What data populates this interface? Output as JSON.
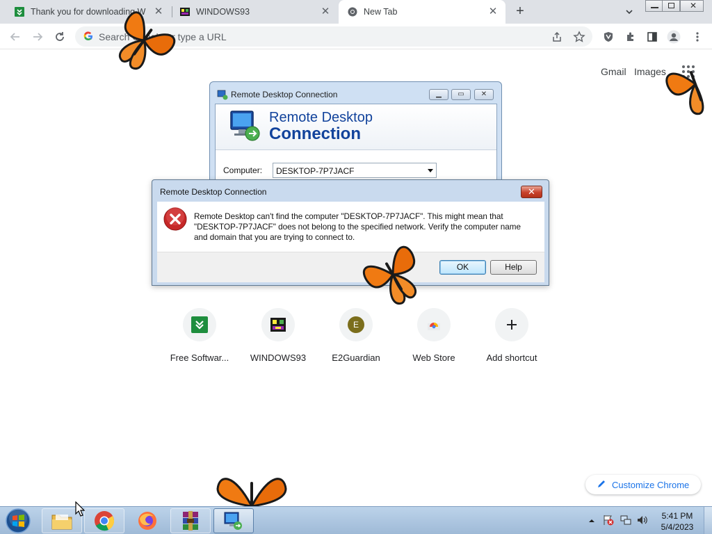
{
  "browser": {
    "tabs": [
      {
        "title": "Thank you for downloading W",
        "favicon": "green-download-favicon",
        "active": false
      },
      {
        "title": "WINDOWS93",
        "favicon": "windows93-favicon",
        "active": false
      },
      {
        "title": "New Tab",
        "favicon": "chrome-favicon",
        "active": true
      }
    ],
    "omnibox_placeholder": "Search Google or type a URL"
  },
  "ntp": {
    "links": {
      "gmail": "Gmail",
      "images": "Images"
    },
    "shortcuts": [
      {
        "label": "Free Softwar...",
        "icon": "green-download-icon"
      },
      {
        "label": "WINDOWS93",
        "icon": "windows93-icon"
      },
      {
        "label": "E2Guardian",
        "icon": "letter-e-icon",
        "letter": "E"
      },
      {
        "label": "Web Store",
        "icon": "web-store-icon"
      },
      {
        "label": "Add shortcut",
        "icon": "plus-icon"
      }
    ],
    "customize_label": "Customize Chrome"
  },
  "rdp_window": {
    "title": "Remote Desktop Connection",
    "heading_line1": "Remote Desktop",
    "heading_line2": "Connection",
    "computer_label": "Computer:",
    "computer_value": "DESKTOP-7P7JACF"
  },
  "error_dialog": {
    "title": "Remote Desktop Connection",
    "message_line1": "Remote Desktop can't find the computer \"DESKTOP-7P7JACF\". This might mean that",
    "message_line2": "\"DESKTOP-7P7JACF\" does not belong to the specified network.  Verify the computer name",
    "message_line3": "and domain that you are trying to connect to.",
    "ok_label": "OK",
    "help_label": "Help",
    "close_glyph": "✕"
  },
  "taskbar": {
    "clock_time": "5:41 PM",
    "clock_date": "5/4/2023",
    "apps": [
      "file-explorer",
      "chrome",
      "firefox",
      "winrar",
      "remote-desktop"
    ]
  },
  "colors": {
    "chrome_tabstrip": "#dee1e6",
    "rdp_heading": "#12439c",
    "error_red": "#c62828",
    "link_blue": "#1a73e8",
    "butterfly_orange": "#f07a12"
  }
}
